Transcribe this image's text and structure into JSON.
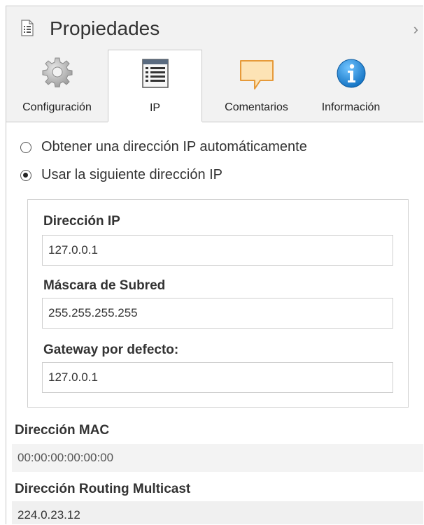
{
  "header": {
    "title": "Propiedades",
    "icon": "properties-icon",
    "collapse_glyph": "›"
  },
  "tabs": [
    {
      "label": "Configuración",
      "icon": "gear-icon",
      "active": false
    },
    {
      "label": "IP",
      "icon": "ip-list-icon",
      "active": true
    },
    {
      "label": "Comentarios",
      "icon": "comment-icon",
      "active": false
    },
    {
      "label": "Información",
      "icon": "info-icon",
      "active": false
    }
  ],
  "ip": {
    "auto_option": "Obtener una dirección IP automáticamente",
    "manual_option": "Usar la siguiente dirección IP",
    "selected": "manual",
    "address_label": "Dirección IP",
    "address_value": "127.0.0.1",
    "mask_label": "Máscara de Subred",
    "mask_value": "255.255.255.255",
    "gateway_label": "Gateway por defecto:",
    "gateway_value": "127.0.0.1"
  },
  "mac": {
    "label": "Dirección MAC",
    "value": "00:00:00:00:00:00"
  },
  "multicast": {
    "label": "Dirección Routing Multicast",
    "value": "224.0.23.12"
  },
  "colors": {
    "tab_bg": "#f2f2f2",
    "info_blue": "#1f8ad8",
    "comment_orange": "#f0a040",
    "border": "#c8c8c8"
  }
}
